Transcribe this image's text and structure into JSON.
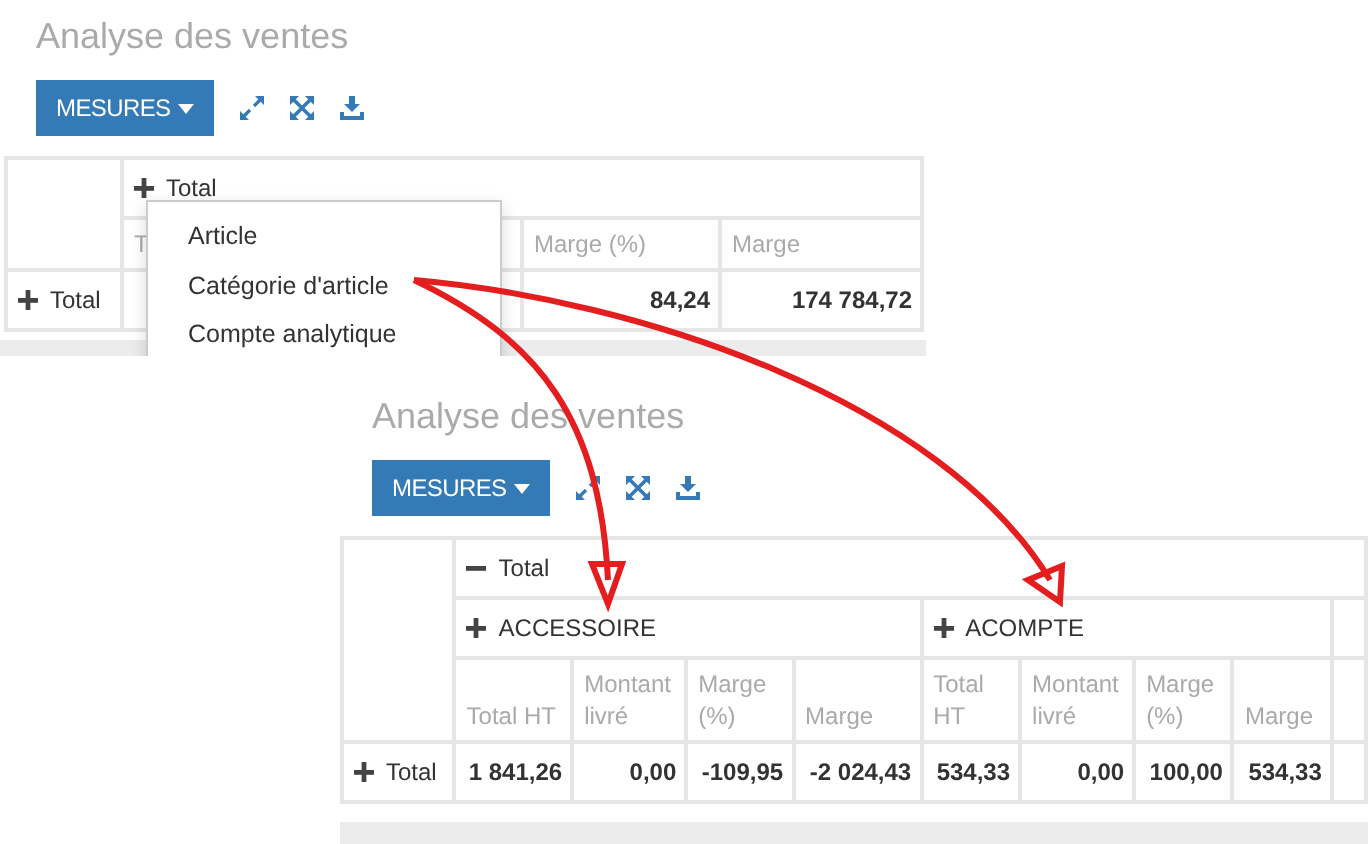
{
  "panels": [
    {
      "title": "Analyse des ventes",
      "measures_button": "MESURES",
      "table": {
        "total": {
          "label": "Total",
          "expanded": false
        },
        "columns": [
          "T",
          "Marge (%)",
          "Marge"
        ],
        "rows": [
          {
            "label": "Total",
            "expanded": false,
            "cells": [
              "",
              "84,24",
              "174 784,72"
            ]
          }
        ]
      },
      "dropdown_menu": [
        "Article",
        "Catégorie d'article",
        "Compte analytique"
      ]
    },
    {
      "title": "Analyse des ventes",
      "measures_button": "MESURES",
      "table": {
        "total": {
          "label": "Total",
          "expanded": true
        },
        "groups": [
          {
            "label": "ACCESSOIRE",
            "expanded": false
          },
          {
            "label": "ACOMPTE",
            "expanded": false
          }
        ],
        "columns": [
          "Total HT",
          "Montant livré",
          "Marge (%)",
          "Marge",
          "Total HT",
          "Montant livré",
          "Marge (%)",
          "Marge"
        ],
        "rows": [
          {
            "label": "Total",
            "expanded": false,
            "cells": [
              "1 841,26",
              "0,00",
              "-109,95",
              "-2 024,43",
              "534,33",
              "0,00",
              "100,00",
              "534,33"
            ]
          }
        ]
      }
    }
  ]
}
